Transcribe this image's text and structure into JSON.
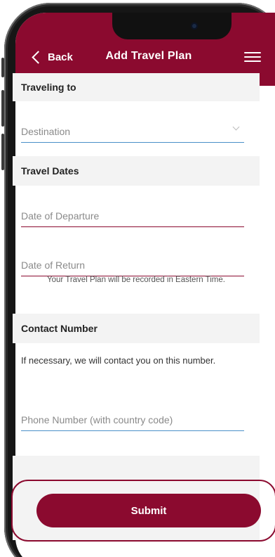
{
  "header": {
    "back_label": "Back",
    "title": "Add Travel Plan"
  },
  "sections": {
    "traveling_to": "Traveling to",
    "travel_dates": "Travel Dates",
    "contact_number": "Contact Number"
  },
  "fields": {
    "destination_placeholder": "Destination",
    "departure_placeholder": "Date of Departure",
    "return_placeholder": "Date of Return",
    "phone_placeholder": "Phone Number (with country code)"
  },
  "note": "Your Travel Plan will be recorded in Eastern Time.",
  "contact_info": "If necessary, we will contact you on this number.",
  "submit_label": "Submit",
  "colors": {
    "brand": "#8b0a2f",
    "input_focus": "#4a90c8",
    "section_bg": "#f3f3f3"
  },
  "icons": [
    "back-chevron-icon",
    "hamburger-menu-icon",
    "dropdown-chevron-icon"
  ]
}
